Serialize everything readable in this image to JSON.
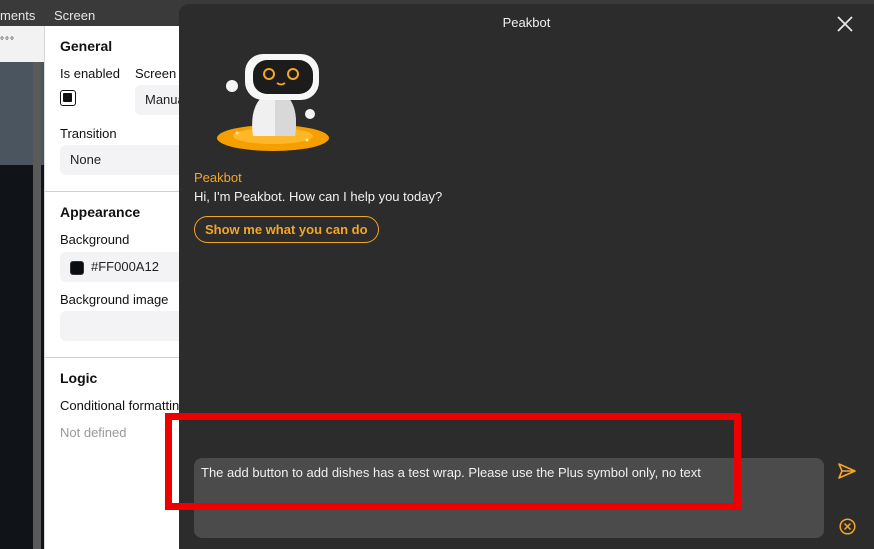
{
  "topbar": {
    "tab_components": "ments",
    "tab_screen": "Screen"
  },
  "left_strip": {
    "dots": "°°°"
  },
  "properties": {
    "general_heading": "General",
    "is_enabled_label": "Is enabled",
    "screen_label": "Screen",
    "screen_value": "Manual",
    "transition_label": "Transition",
    "transition_value": "None",
    "appearance_heading": "Appearance",
    "background_label": "Background",
    "background_value": "#FF000A12",
    "background_image_label": "Background image",
    "background_image_value": "",
    "logic_heading": "Logic",
    "conditional_label": "Conditional formatting",
    "conditional_value": "Not defined"
  },
  "chat": {
    "title": "Peakbot",
    "bot_name": "Peakbot",
    "bot_message": "Hi, I'm Peakbot. How can I help you today?",
    "suggestion": "Show me what you can do",
    "input_text": "The add button to add dishes has a test wrap. Please use the Plus symbol only, no text",
    "icons": {
      "close": "close-icon",
      "send": "send-icon",
      "cancel": "cancel-icon"
    }
  },
  "colors": {
    "accent": "#f5a623",
    "chat_bg": "#2c2c2c",
    "input_bg": "#4b4b4b",
    "highlight": "#ee0000"
  }
}
